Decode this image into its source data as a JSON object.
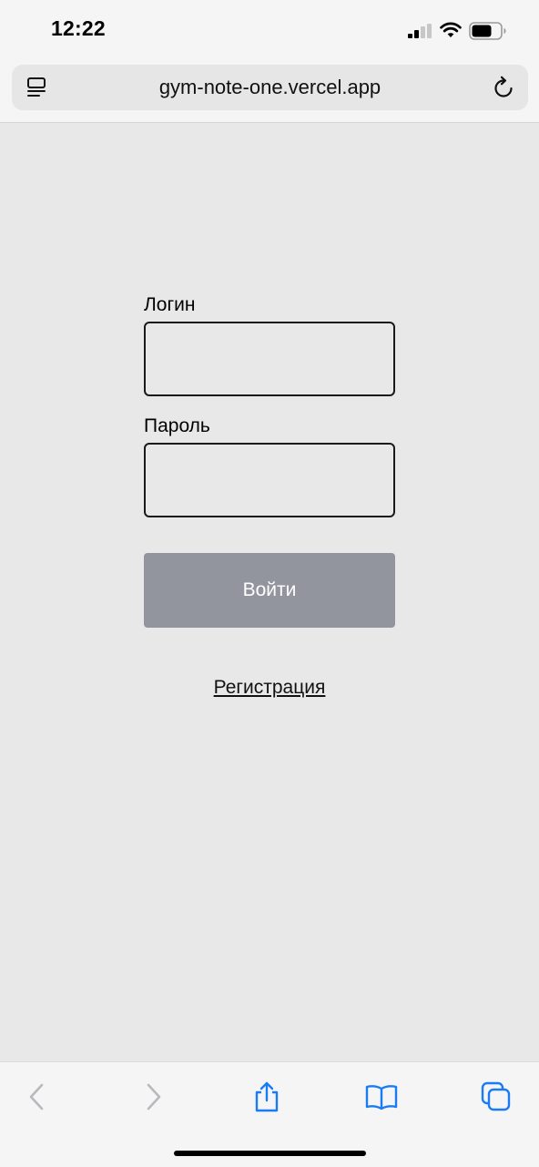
{
  "status_bar": {
    "time": "12:22"
  },
  "browser": {
    "url": "gym-note-one.vercel.app"
  },
  "form": {
    "login_label": "Логин",
    "login_value": "",
    "password_label": "Пароль",
    "password_value": "",
    "submit_label": "Войти",
    "register_link": "Регистрация"
  },
  "icons": {
    "reader": "reader-mode-icon",
    "reload": "reload-icon",
    "back": "chevron-left-icon",
    "forward": "chevron-right-icon",
    "share": "share-icon",
    "bookmarks": "book-icon",
    "tabs": "tabs-icon"
  },
  "colors": {
    "page_background": "#e8e8e9",
    "button_background": "#92959d",
    "button_text": "#ffffff",
    "toolbar_accent": "#1a7cf5",
    "toolbar_disabled": "#b8b8bd"
  }
}
